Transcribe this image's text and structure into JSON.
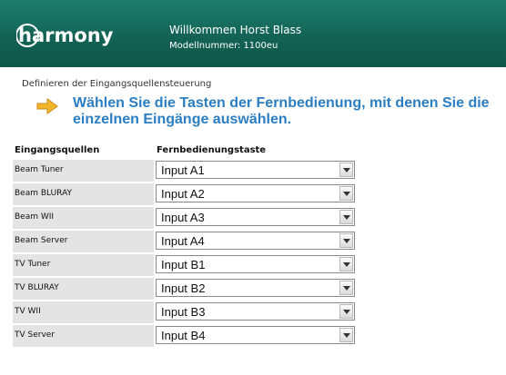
{
  "header": {
    "logo_text": "harmony",
    "welcome": "Willkommen Horst Blass",
    "model_label": "Modellnummer:",
    "model_value": "1100eu"
  },
  "page": {
    "section_title": "Definieren der Eingangsquellensteuerung",
    "instruction": "Wählen Sie die Tasten der Fernbedienung, mit denen Sie die einzelnen Eingänge auswählen."
  },
  "table": {
    "headers": [
      "Eingangsquellen",
      "Fernbedienungstaste"
    ],
    "rows": [
      {
        "source": "Beam Tuner",
        "button": "Input A1"
      },
      {
        "source": "Beam BLURAY",
        "button": "Input A2"
      },
      {
        "source": "Beam WII",
        "button": "Input A3"
      },
      {
        "source": "Beam Server",
        "button": "Input A4"
      },
      {
        "source": "TV Tuner",
        "button": "Input B1"
      },
      {
        "source": "TV BLURAY",
        "button": "Input B2"
      },
      {
        "source": "TV WII",
        "button": "Input B3"
      },
      {
        "source": "TV Server",
        "button": "Input B4"
      }
    ]
  },
  "icons": {
    "instruction_arrow": "arrow-right-icon",
    "dropdown": "chevron-down-icon"
  },
  "colors": {
    "header": "#136355",
    "instruction_text": "#2b7ec4",
    "arrow": "#f2b52a"
  }
}
